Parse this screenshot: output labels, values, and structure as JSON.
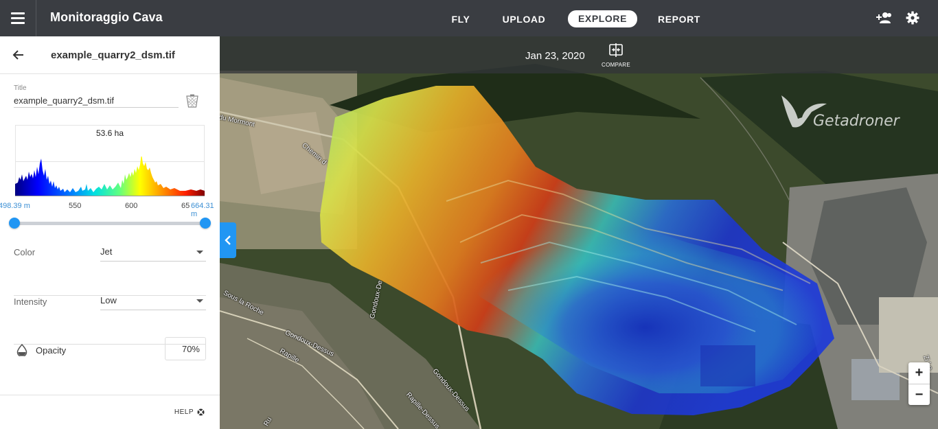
{
  "app": {
    "title": "Monitoraggio Cava"
  },
  "nav": {
    "items": [
      "FLY",
      "UPLOAD",
      "EXPLORE",
      "REPORT"
    ],
    "active": "EXPLORE"
  },
  "icons": {
    "menu": "hamburger-icon",
    "users": "add-user-icon",
    "settings": "gear-icon",
    "back": "arrow-left-icon",
    "trash": "trash-icon",
    "compare": "compare-icon",
    "opacity": "droplet-icon",
    "help": "lifebuoy-icon",
    "collapse": "chevron-left-icon"
  },
  "sidebar": {
    "filename": "example_quarry2_dsm.tif",
    "title_label": "Title",
    "title_value": "example_quarry2_dsm.tif",
    "histogram": {
      "area_label": "53.6 ha",
      "ticks": [
        "550",
        "600",
        "65"
      ],
      "min_label": "498.39 m",
      "max_label": "664.31 m"
    },
    "color": {
      "label": "Color",
      "value": "Jet"
    },
    "intensity": {
      "label": "Intensity",
      "value": "Low"
    },
    "opacity": {
      "label": "Opacity",
      "value": "70%"
    },
    "help_label": "HELP"
  },
  "map": {
    "date": "Jan 23, 2020",
    "compare_label": "COMPARE",
    "zoom_in": "+",
    "zoom_out": "−",
    "watermark": "Getadroner",
    "labels": [
      "du Mormont",
      "Chemin d",
      "Gondoux-De",
      "Sous la Roche",
      "Gondoux-Dessus",
      "Rapille",
      "Gondoux-Dessus",
      "Rapille-Dessus",
      "Zi Le",
      "Ru"
    ]
  },
  "colors": {
    "accent": "#2196f3",
    "topbar": "#3a3d42"
  }
}
